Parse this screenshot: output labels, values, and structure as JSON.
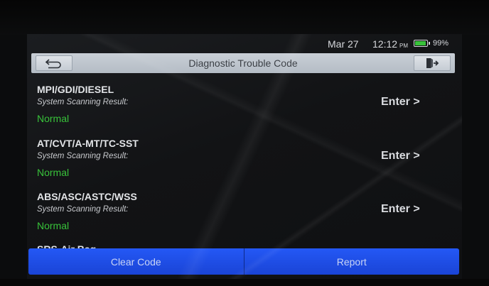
{
  "status": {
    "date": "Mar 27",
    "time": "12:12",
    "ampm": "PM",
    "battery_pct": "99%",
    "battery_level": 0.99,
    "battery_color": "#38c23a"
  },
  "header": {
    "title": "Diagnostic Trouble Code",
    "back_icon": "back-arrow-icon",
    "exit_icon": "exit-door-icon"
  },
  "systems": [
    {
      "name": "MPI/GDI/DIESEL",
      "sub": "System Scanning Result:",
      "status": "Normal",
      "action": "Enter >"
    },
    {
      "name": "AT/CVT/A-MT/TC-SST",
      "sub": "System Scanning Result:",
      "status": "Normal",
      "action": "Enter >"
    },
    {
      "name": "ABS/ASC/ASTC/WSS",
      "sub": "System Scanning Result:",
      "status": "Normal",
      "action": "Enter >"
    }
  ],
  "partial_item": "SRS-Air Bag",
  "footer": {
    "clear_label": "Clear Code",
    "report_label": "Report"
  },
  "colors": {
    "accent": "#1f4fe8",
    "status_ok": "#38c23a"
  }
}
